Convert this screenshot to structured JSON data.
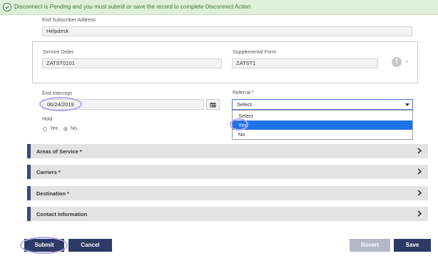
{
  "banner": {
    "message": "Disconnect is Pending and you must submit or save the record to complete Disconnect Action",
    "icon": "check-circle-icon",
    "color": "#3c763d"
  },
  "subscriber": {
    "address_label": "End Subscriber Address",
    "address_value": "Helpdesk"
  },
  "service_order": {
    "label": "Service Order",
    "value": "ZATST0101"
  },
  "supplemental_form": {
    "label": "Supplemental Form",
    "value": "ZATST1",
    "required_mark": "*"
  },
  "end_intercept": {
    "label": "End Intercept",
    "value": "06/24/2019",
    "icon": "calendar-icon"
  },
  "hold": {
    "label": "Hold",
    "options": [
      "Yes",
      "No"
    ],
    "selected": "No"
  },
  "referral": {
    "label": "Referral *",
    "value": "Select",
    "options": [
      "Select",
      "Yes",
      "No"
    ],
    "highlighted": "Yes"
  },
  "sections": [
    {
      "title": "Areas of Service *"
    },
    {
      "title": "Carriers *"
    },
    {
      "title": "Destination *"
    },
    {
      "title": "Contact Information"
    }
  ],
  "buttons": {
    "submit": "Submit",
    "cancel": "Cancel",
    "revert": "Revert",
    "save": "Save"
  },
  "colors": {
    "accent": "#2e3a66",
    "dropdown_highlight": "#1e73e8",
    "annotation_ring": "#b6a7e8"
  }
}
